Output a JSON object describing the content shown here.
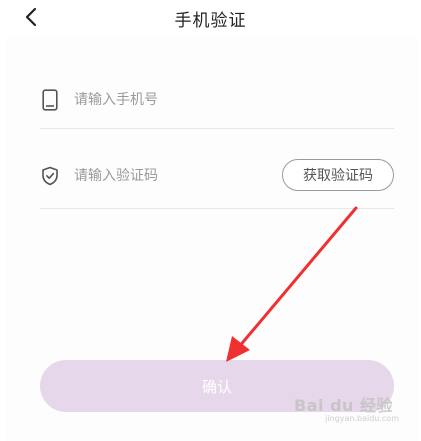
{
  "header": {
    "title": "手机验证"
  },
  "form": {
    "phone": {
      "value": "",
      "placeholder": "请输入手机号",
      "icon": "phone-icon"
    },
    "code": {
      "value": "",
      "placeholder": "请输入验证码",
      "icon": "shield-check-icon",
      "get_code_label": "获取验证码"
    },
    "confirm_label": "确认"
  },
  "watermark": {
    "brand": "Bai du 经验",
    "url": "jingyan.baidu.com"
  },
  "colors": {
    "confirm_bg": "#e6d8ea",
    "annotation_arrow": "#f03030"
  }
}
